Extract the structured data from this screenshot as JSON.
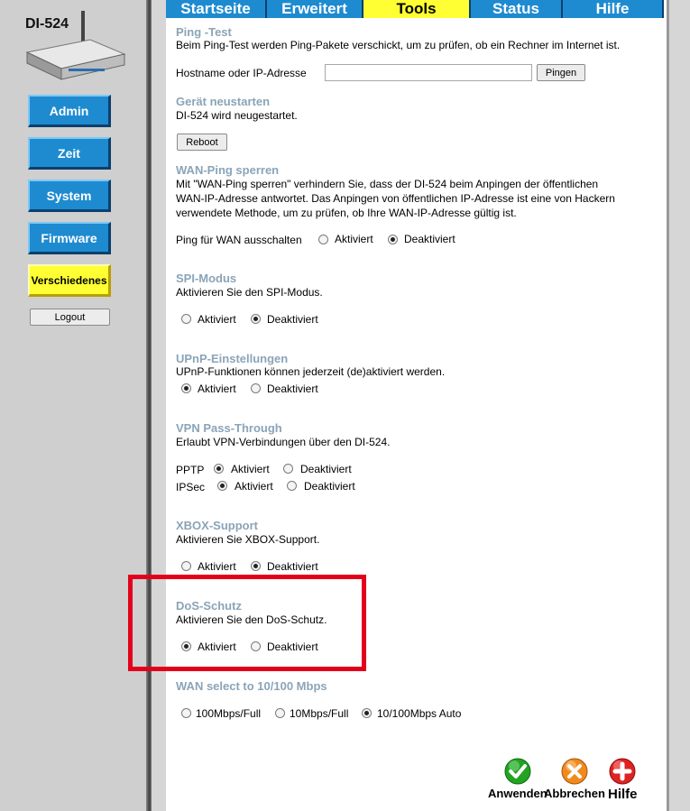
{
  "device": {
    "name": "DI-524"
  },
  "sidebar": {
    "items": [
      {
        "label": "Admin"
      },
      {
        "label": "Zeit"
      },
      {
        "label": "System"
      },
      {
        "label": "Firmware"
      },
      {
        "label": "Verschiedenes"
      }
    ],
    "active_index": 4,
    "logout_label": "Logout"
  },
  "tabs": {
    "items": [
      {
        "label": "Startseite"
      },
      {
        "label": "Erweitert"
      },
      {
        "label": "Tools"
      },
      {
        "label": "Status"
      },
      {
        "label": "Hilfe"
      }
    ],
    "active_index": 2
  },
  "ping": {
    "title": "Ping -Test",
    "desc": "Beim Ping-Test werden Ping-Pakete verschickt, um zu prüfen, ob ein Rechner im Internet ist.",
    "field_label": "Hostname oder IP-Adresse",
    "value": "",
    "button": "Pingen"
  },
  "restart": {
    "title": "Gerät neustarten",
    "desc": "DI-524 wird neugestartet.",
    "button": "Reboot"
  },
  "wan_ping": {
    "title": "WAN-Ping sperren",
    "desc_line1": "Mit \"WAN-Ping sperren\" verhindern Sie, dass der DI-524 beim Anpingen der öffentlichen",
    "desc_line2": "WAN-IP-Adresse antwortet. Das Anpingen von öffentlichen IP-Adresse ist eine von Hackern",
    "desc_line3": "verwendete Methode, um zu prüfen, ob Ihre WAN-IP-Adresse gültig ist.",
    "option_label": "Ping für WAN ausschalten",
    "on_label": "Aktiviert",
    "off_label": "Deaktiviert",
    "selected": "Deaktiviert"
  },
  "spi": {
    "title": "SPI-Modus",
    "desc": "Aktivieren Sie den SPI-Modus.",
    "on_label": "Aktiviert",
    "off_label": "Deaktiviert",
    "selected": "Deaktiviert"
  },
  "upnp": {
    "title": "UPnP-Einstellungen",
    "desc": "UPnP-Funktionen können jederzeit (de)aktiviert werden.",
    "on_label": "Aktiviert",
    "off_label": "Deaktiviert",
    "selected": "Aktiviert"
  },
  "vpn": {
    "title": "VPN Pass-Through",
    "desc": "Erlaubt VPN-Verbindungen über den DI-524.",
    "pptp_label": "PPTP",
    "ipsec_label": "IPSec",
    "on_label": "Aktiviert",
    "off_label": "Deaktiviert",
    "pptp_selected": "Aktiviert",
    "ipsec_selected": "Aktiviert"
  },
  "xbox": {
    "title": "XBOX-Support",
    "desc": "Aktivieren Sie XBOX-Support.",
    "on_label": "Aktiviert",
    "off_label": "Deaktiviert",
    "selected": "Deaktiviert"
  },
  "dos": {
    "title": "DoS-Schutz",
    "desc": "Aktivieren Sie den DoS-Schutz.",
    "on_label": "Aktiviert",
    "off_label": "Deaktiviert",
    "selected": "Aktiviert"
  },
  "wan_speed": {
    "title": "WAN select to 10/100 Mbps",
    "options": [
      "100Mbps/Full",
      "10Mbps/Full",
      "10/100Mbps Auto"
    ],
    "selected": "10/100Mbps Auto"
  },
  "actions": {
    "apply": "Anwenden",
    "cancel": "Abbrechen",
    "help": "Hilfe"
  },
  "colors": {
    "tab_blue": "#1e8bd0",
    "active_yellow": "#ffff33",
    "section_title": "#8aa4b8",
    "highlight_red": "#e3001b"
  }
}
